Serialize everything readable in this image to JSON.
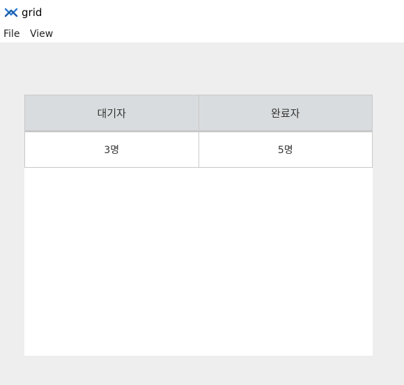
{
  "window": {
    "title": "grid",
    "icon": "app-logo-icon"
  },
  "menubar": {
    "items": [
      {
        "label": "File"
      },
      {
        "label": "View"
      }
    ]
  },
  "grid": {
    "columns": [
      "대기자",
      "완료자"
    ],
    "rows": [
      [
        "3명",
        "5명"
      ]
    ]
  }
}
